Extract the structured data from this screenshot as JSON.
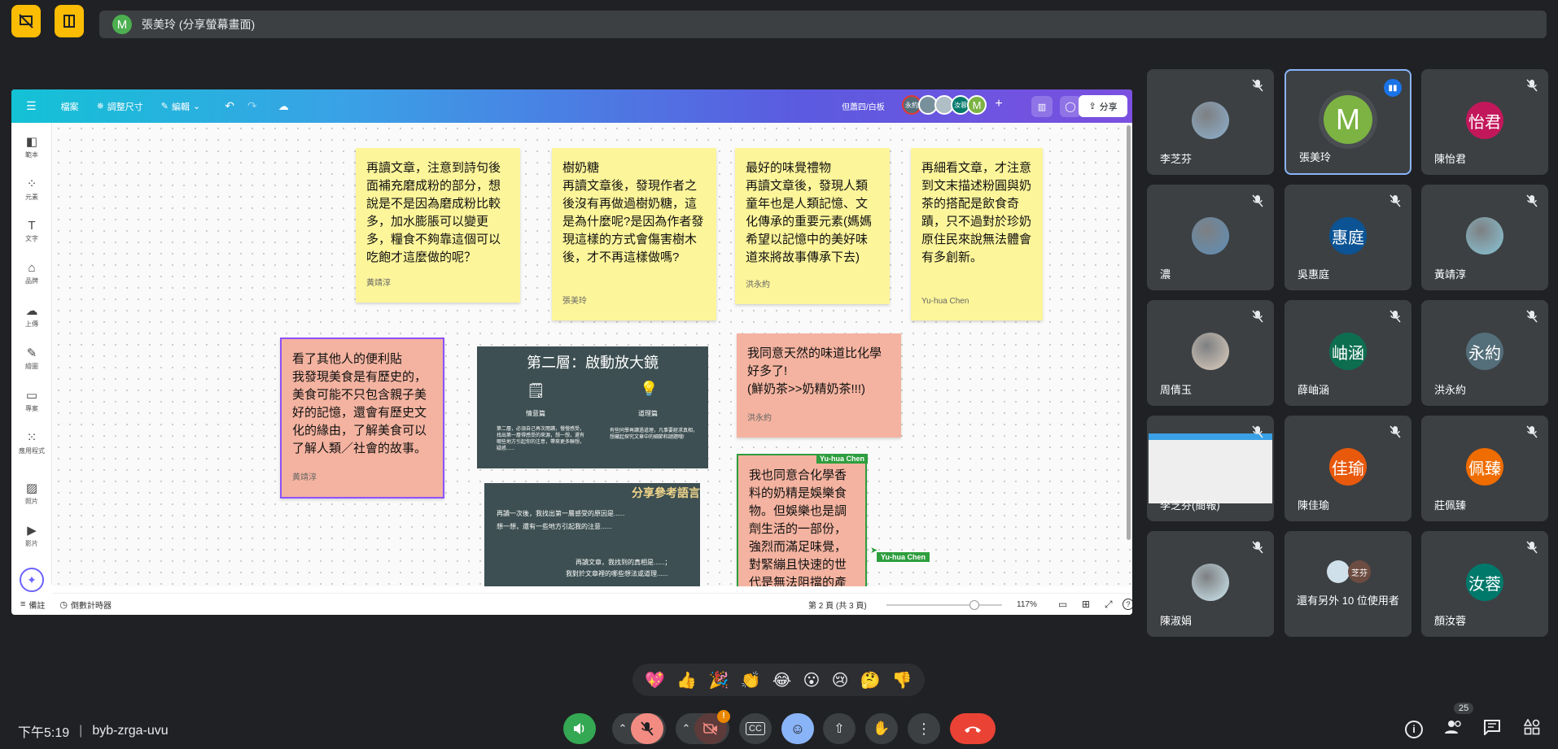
{
  "top": {
    "presenter_initial": "M",
    "presenter_label": "張美玲 (分享螢幕畫面)"
  },
  "whiteboard": {
    "menu": {
      "file": "檔案",
      "resize": "調整尺寸",
      "edit": "編輯"
    },
    "doc_title": "但蕭四/白板",
    "collab_labels": [
      "永約",
      "汝蓉",
      "M"
    ],
    "share_label": "分享",
    "left_tools": [
      "範本",
      "元素",
      "文字",
      "品牌",
      "上傳",
      "繪圖",
      "專案",
      "應用程式",
      "照片",
      "影片"
    ],
    "notes": [
      {
        "text": "再讀文章，注意到詩句後面補充磨成粉的部分，想說是不是因為磨成粉比較多，加水膨脹可以變更多，糧食不夠靠這個可以吃飽才這麼做的呢？",
        "author": "黃靖淳"
      },
      {
        "text": "樹奶糖\n再讀文章後，發現作者之後沒有再做過樹奶糖，這是為什麼呢?是因為作者發現這樣的方式會傷害樹木後，才不再這樣做嗎?",
        "author": "張美玲"
      },
      {
        "text": "最好的味覺禮物\n再讀文章後，發現人類童年也是人類記憶、文化傳承的重要元素(媽媽希望以記憶中的美好味道來將故事傳承下去)",
        "author": "洪永約"
      },
      {
        "text": "再細看文章，才注意到文末描述粉圓與奶茶的搭配是飲食奇蹟，只不過對於珍奶原住民來說無法體會有多創新。",
        "author": "Yu-hua Chen"
      },
      {
        "text": "看了其他人的便利貼\n我發現美食是有歷史的，美食可能不只包含親子美好的記憶，還會有歷史文化的緣由，了解美食可以了解人類／社會的故事。",
        "author": "黃靖淳"
      },
      {
        "text": "我同意天然的味道比化學好多了!\n(鮮奶茶>>奶精奶茶!!!)",
        "author": "洪永約"
      },
      {
        "text": "我也同意合化學香料的奶精是娛樂食物。但娛樂也是調劑生活的一部份，強烈而滿足味覺，對緊繃且快速的世代是無法阻擋的產",
        "author": ""
      }
    ],
    "slide1": {
      "title": "第二層：啟動放大鏡",
      "left_head": "情意篇",
      "right_head": "道理篇",
      "left_body": "第二層，必須自己再次閱讀，慢慢感受，找出第一層得感受的來源，想一想，還有哪些地方引起你的注意，帶來更多聯想，疑惑......",
      "right_body": "有些同學再讀過道理，凡事要經求真相，想藏起探究文章中的細節和謎題哦!"
    },
    "slide2": {
      "title": "分享參考語言",
      "line1": "再讀一次後，我找出第一層感受的原因是......",
      "line2": "想一想，還有一些地方引起我的注意......",
      "line3": "再讀文章，我找到的真相是......；",
      "line4": "我對於文章裡的哪些想法或道理......"
    },
    "cursor_label": "Yu-hua Chen",
    "bottom": {
      "notes": "備註",
      "timer": "倒數計時器",
      "page": "第 2 頁 (共 3 頁)",
      "zoom": "117%",
      "zoom_level": 0.72
    }
  },
  "participants": [
    {
      "name": "李芝芬",
      "type": "photo",
      "color": "#8fb1cf"
    },
    {
      "name": "張美玲",
      "type": "avatar",
      "initial": "M",
      "color": "#7cb342",
      "active": true
    },
    {
      "name": "陳怡君",
      "type": "avatar",
      "initial": "怡君",
      "color": "#c2185b"
    },
    {
      "name": "濃",
      "type": "photo",
      "color": "#5f8fb8"
    },
    {
      "name": "吳惠庭",
      "type": "avatar",
      "initial": "惠庭",
      "color": "#0b5394"
    },
    {
      "name": "黃靖淳",
      "type": "photo",
      "color": "#8ac6d8"
    },
    {
      "name": "周倩玉",
      "type": "photo",
      "color": "#e0d0c0"
    },
    {
      "name": "薛岫涵",
      "type": "avatar",
      "initial": "岫涵",
      "color": "#0d6e4f"
    },
    {
      "name": "洪永約",
      "type": "avatar",
      "initial": "永約",
      "color": "#546e7a"
    },
    {
      "name": "李芝芬(簡報)",
      "type": "screen",
      "color": "#eeeeee"
    },
    {
      "name": "陳佳瑜",
      "type": "avatar",
      "initial": "佳瑜",
      "color": "#e8590c"
    },
    {
      "name": "莊佩臻",
      "type": "avatar",
      "initial": "佩臻",
      "color": "#ef6c00"
    },
    {
      "name": "陳淑娟",
      "type": "photo",
      "color": "#cfe9f2"
    },
    {
      "name": "還有另外 10 位使用者",
      "type": "more",
      "initial": "芝芬",
      "color": "#6d4c41"
    },
    {
      "name": "顏汝蓉",
      "type": "avatar",
      "initial": "汝蓉",
      "color": "#00796b"
    }
  ],
  "reactions": [
    "💖",
    "👍",
    "🎉",
    "👏",
    "😂",
    "😮",
    "😢",
    "🤔",
    "👎"
  ],
  "footer": {
    "time": "下午5:19",
    "meeting_code": "byb-zrga-uvu",
    "participant_count": "25",
    "notification_count": "!"
  },
  "colors": {
    "accent_blue": "#8ab4f8",
    "hangup_red": "#ea4335",
    "mic_green": "#34a853",
    "mic_off_red": "#f28b82"
  }
}
